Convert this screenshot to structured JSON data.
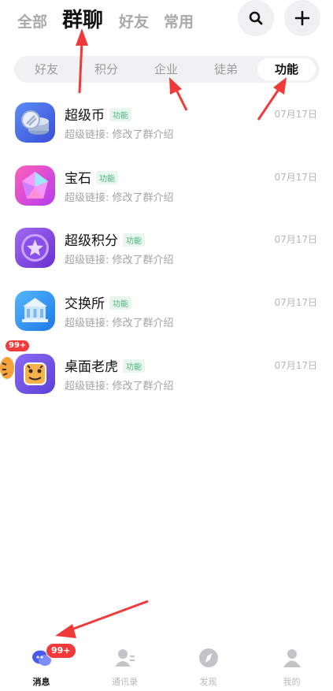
{
  "header": {
    "tabs": [
      {
        "label": "全部",
        "active": false
      },
      {
        "label": "群聊",
        "active": true
      },
      {
        "label": "好友",
        "active": false
      },
      {
        "label": "常用",
        "active": false
      }
    ],
    "search_icon": "search-icon",
    "add_icon": "plus-icon"
  },
  "segment": {
    "items": [
      {
        "label": "好友",
        "active": false
      },
      {
        "label": "积分",
        "active": false
      },
      {
        "label": "企业",
        "active": false
      },
      {
        "label": "徒弟",
        "active": false
      },
      {
        "label": "功能",
        "active": true
      }
    ]
  },
  "chats": [
    {
      "title": "超级币",
      "tag": "功能",
      "subtitle": "超级链接: 修改了群介绍",
      "time": "07月17日",
      "icon": "coins-icon"
    },
    {
      "title": "宝石",
      "tag": "功能",
      "subtitle": "超级链接: 修改了群介绍",
      "time": "07月17日",
      "icon": "gem-icon"
    },
    {
      "title": "超级积分",
      "tag": "功能",
      "subtitle": "超级链接: 修改了群介绍",
      "time": "07月17日",
      "icon": "star-icon"
    },
    {
      "title": "交换所",
      "tag": "功能",
      "subtitle": "超级链接: 修改了群介绍",
      "time": "07月17日",
      "icon": "bank-icon"
    },
    {
      "title": "桌面老虎",
      "tag": "功能",
      "subtitle": "超级链接: 修改了群介绍",
      "time": "07月17日",
      "icon": "tiger-icon",
      "badge": "99+"
    }
  ],
  "bottom_nav": [
    {
      "label": "消息",
      "active": true,
      "icon": "message-icon",
      "badge": "99+"
    },
    {
      "label": "通讯录",
      "active": false,
      "icon": "contacts-icon"
    },
    {
      "label": "发现",
      "active": false,
      "icon": "compass-icon"
    },
    {
      "label": "我的",
      "active": false,
      "icon": "profile-icon"
    }
  ],
  "colors": {
    "accent": "#4a5cf0",
    "badge": "#f23a3a",
    "tag_text": "#49b37e",
    "annotation_arrow": "#f03a3a"
  }
}
